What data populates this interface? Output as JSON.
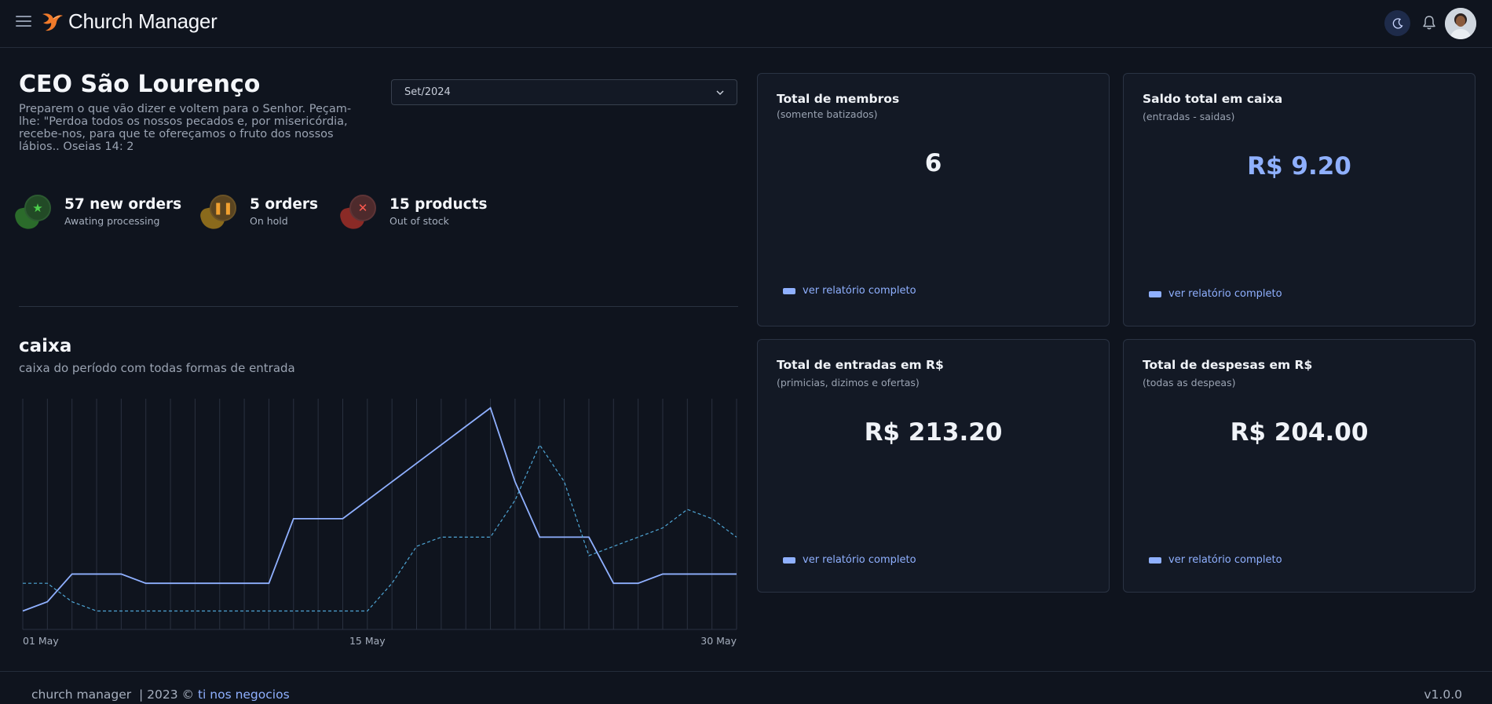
{
  "header": {
    "app_title": "Church Manager",
    "menu_icon": "hamburger-menu-icon",
    "theme_icon": "moon-icon",
    "notification_icon": "bell-icon",
    "avatar": "user-avatar"
  },
  "page": {
    "title": "CEO São Lourenço",
    "verse": "Preparem o que vão dizer e voltem para o Senhor. Peçam-lhe: \"Perdoa todos os nossos pecados e, por misericórdia, recebe-nos, para que te ofereçamos o fruto dos nossos lábios.. Oseias 14: 2"
  },
  "month_select": {
    "value": "Set/2024"
  },
  "stats": [
    {
      "number": "57 new orders",
      "label": "Awating processing",
      "icon": "star-icon",
      "color": "#2f8f2f"
    },
    {
      "number": "5 orders",
      "label": "On hold",
      "icon": "pause-icon",
      "color": "#c8901e"
    },
    {
      "number": "15 products",
      "label": "Out of stock",
      "icon": "x-icon",
      "color": "#b0302e"
    }
  ],
  "caixa": {
    "title": "caixa",
    "subtitle": "caixa do período com todas formas de entrada"
  },
  "chart_data": {
    "type": "line",
    "x_tick_labels": [
      "01 May",
      "15 May",
      "30 May"
    ],
    "x": [
      1,
      2,
      3,
      4,
      5,
      6,
      7,
      8,
      9,
      10,
      11,
      12,
      13,
      14,
      15,
      16,
      17,
      18,
      19,
      20,
      21,
      22,
      23,
      24,
      25,
      26,
      27,
      28,
      29,
      30
    ],
    "series": [
      {
        "style": "solid",
        "color": "#8fb0ff",
        "values": [
          1.0,
          1.5,
          3.0,
          3.0,
          3.0,
          2.5,
          2.5,
          2.5,
          2.5,
          2.5,
          2.5,
          6.0,
          6.0,
          6.0,
          7.0,
          8.0,
          9.0,
          10.0,
          11.0,
          12.0,
          8.0,
          5.0,
          5.0,
          5.0,
          2.5,
          2.5,
          3.0,
          3.0,
          3.0,
          3.0
        ]
      },
      {
        "style": "dashed",
        "color": "#4fa6d6",
        "values": [
          2.5,
          2.5,
          1.5,
          1.0,
          1.0,
          1.0,
          1.0,
          1.0,
          1.0,
          1.0,
          1.0,
          1.0,
          1.0,
          1.0,
          1.0,
          2.5,
          4.5,
          5.0,
          5.0,
          5.0,
          7.0,
          10.0,
          8.0,
          4.0,
          4.5,
          5.0,
          5.5,
          6.5,
          6.0,
          5.0
        ]
      }
    ],
    "ylim": [
      0,
      12.5
    ],
    "grid": "vertical"
  },
  "cards": [
    {
      "title": "Total de membros",
      "subtitle": "(somente batizados)",
      "value": "6",
      "value_color": "#f0f3f8",
      "link": "ver relatório completo"
    },
    {
      "title": "Saldo total em caixa",
      "subtitle": "(entradas - saidas)",
      "value": "R$ 9.20",
      "value_color": "#8fb0ff",
      "link": "ver relatório completo"
    },
    {
      "title": "Total de entradas em R$",
      "subtitle": "(primicias, dizimos e ofertas)",
      "value": "R$ 213.20",
      "value_color": "#f0f3f8",
      "link": "ver relatório completo"
    },
    {
      "title": "Total de despesas em R$",
      "subtitle": "(todas as despeas)",
      "value": "R$ 204.00",
      "value_color": "#f0f3f8",
      "link": "ver relatório completo"
    }
  ],
  "footer": {
    "text": "church manager  | 2023 © ",
    "link": "ti nos negocios",
    "version": "v1.0.0"
  }
}
